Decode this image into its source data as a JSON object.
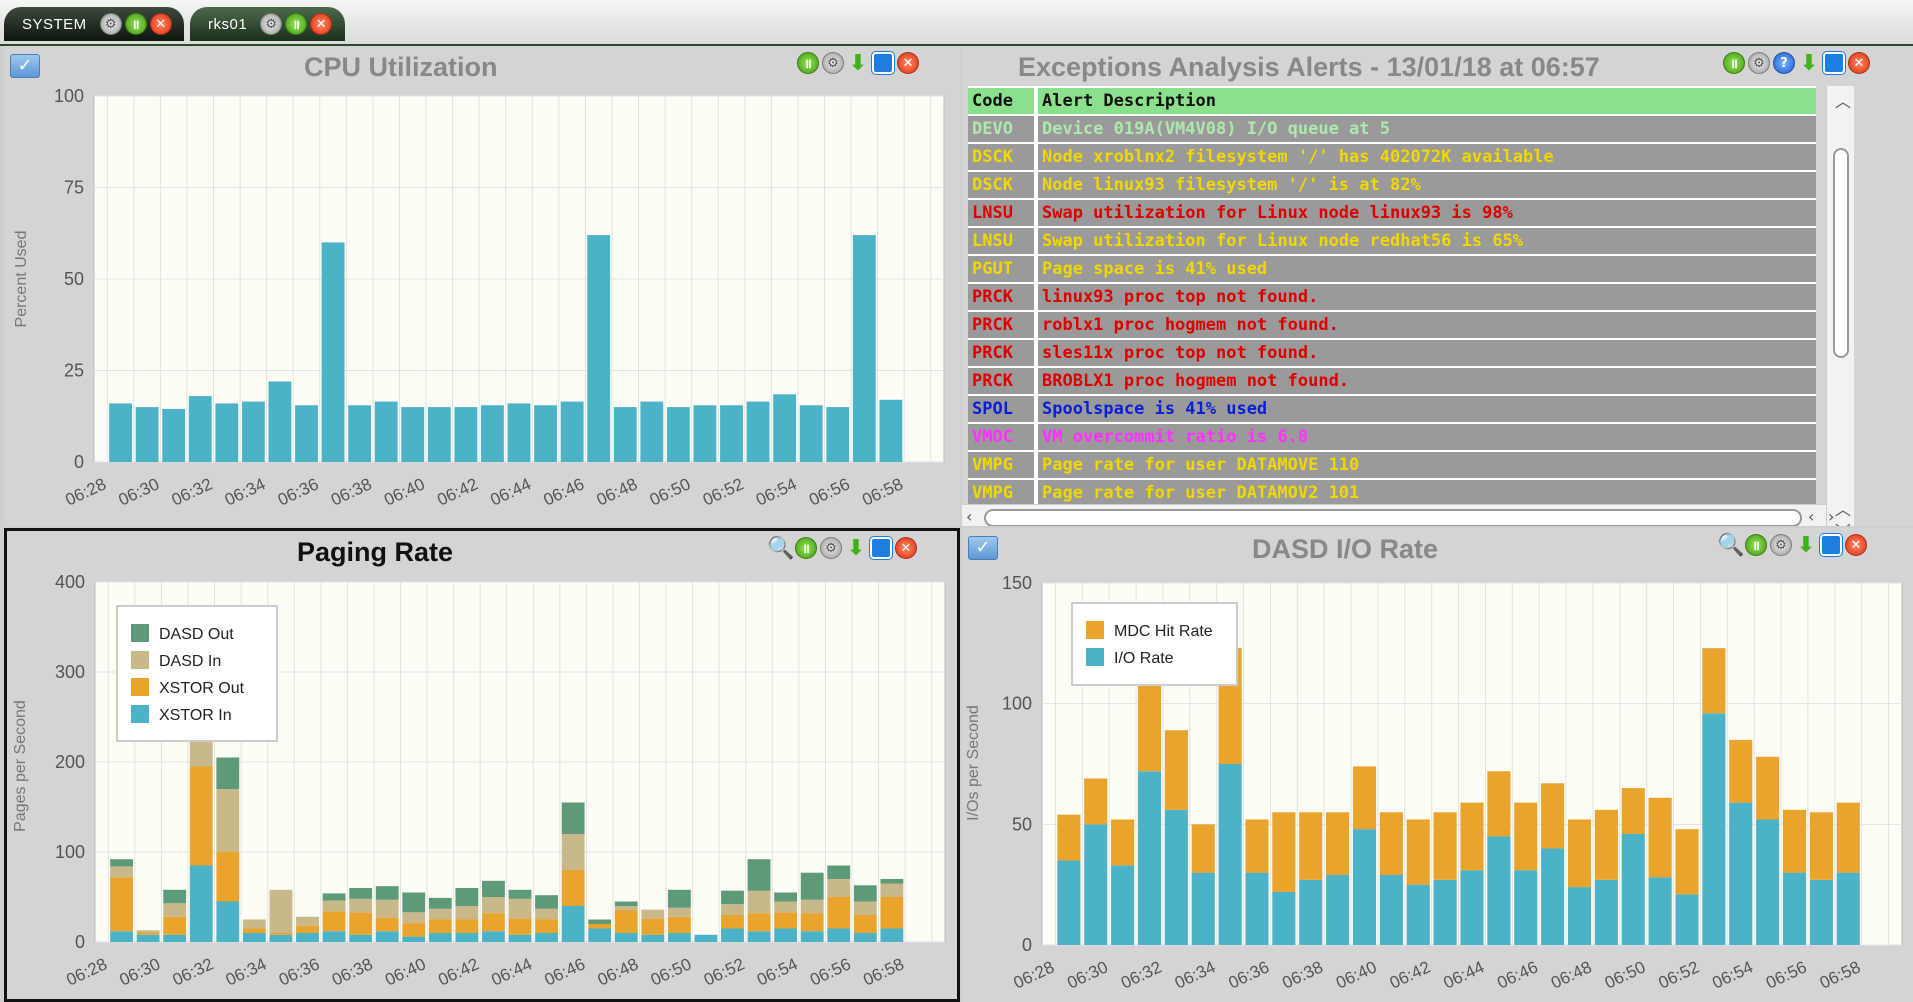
{
  "tabs": [
    {
      "label": "SYSTEM",
      "active": true
    },
    {
      "label": "rks01",
      "active": false
    }
  ],
  "icons": {
    "gear": "gear-icon",
    "pause": "pause-icon",
    "close": "close-icon",
    "maximize": "maximize-icon",
    "download": "download-icon",
    "help": "help-icon",
    "zoom": "magnifier-icon",
    "collapse": "chevron-down-icon"
  },
  "colors": {
    "teal": "#4cb2c8",
    "orange": "#e9a42e",
    "tan": "#c9b88a",
    "green": "#5c9a78",
    "header_green": "#8be08b",
    "row_gray": "#9a9a9a",
    "plot_bg": "#fdfdf6"
  },
  "cpu": {
    "title": "CPU Utilization",
    "chart_data": {
      "type": "bar",
      "title": "CPU Utilization",
      "ylabel": "Percent Used",
      "ylim": [
        0,
        100
      ],
      "yticks": [
        0,
        25,
        50,
        75,
        100
      ],
      "xticks": [
        "06:28",
        "06:30",
        "06:32",
        "06:34",
        "06:36",
        "06:38",
        "06:40",
        "06:42",
        "06:44",
        "06:46",
        "06:48",
        "06:50",
        "06:52",
        "06:54",
        "06:56",
        "06:58"
      ],
      "values": [
        16,
        15,
        14.5,
        18,
        16,
        16.5,
        22,
        15.5,
        60,
        15.5,
        16.5,
        15,
        15,
        15,
        15.5,
        16,
        15.5,
        16.5,
        62,
        15,
        16.5,
        15,
        15.5,
        15.5,
        16.5,
        18.5,
        15.5,
        15,
        62,
        17
      ]
    }
  },
  "alerts": {
    "title": "Exceptions Analysis Alerts - 13/01/18 at 06:57",
    "header": {
      "code": "Code",
      "desc": "Alert Description"
    },
    "rows": [
      {
        "code": "DEVO",
        "desc": "Device 019A(VM4V08) I/O queue at 5",
        "color": "#aee8ae"
      },
      {
        "code": "DSCK",
        "desc": "Node xroblnx2 filesystem '/' has 402072K available",
        "color": "#f0d800"
      },
      {
        "code": "DSCK",
        "desc": "Node linux93 filesystem '/' is at 82%",
        "color": "#f0d800"
      },
      {
        "code": "LNSU",
        "desc": "Swap utilization for Linux node linux93 is 98%",
        "color": "#e00000"
      },
      {
        "code": "LNSU",
        "desc": "Swap utilization for Linux node redhat56 is 65%",
        "color": "#f0d800"
      },
      {
        "code": "PGUT",
        "desc": "Page space is 41% used",
        "color": "#f0d800"
      },
      {
        "code": "PRCK",
        "desc": "linux93 proc top not found.",
        "color": "#e00000"
      },
      {
        "code": "PRCK",
        "desc": "roblx1 proc hogmem not found.",
        "color": "#e00000"
      },
      {
        "code": "PRCK",
        "desc": "sles11x proc top not found.",
        "color": "#e00000"
      },
      {
        "code": "PRCK",
        "desc": "BROBLX1 proc hogmem not found.",
        "color": "#e00000"
      },
      {
        "code": "SPOL",
        "desc": "Spoolspace is 41% used",
        "color": "#0a1ed8"
      },
      {
        "code": "VMOC",
        "desc": "VM overcommit ratio is 6.8",
        "color": "#ff30ff"
      },
      {
        "code": "VMPG",
        "desc": "Page rate for user DATAMOVE 110",
        "color": "#f0d800"
      },
      {
        "code": "VMPG",
        "desc": "Page rate for user DATAMOV2 101",
        "color": "#f0d800"
      }
    ]
  },
  "paging": {
    "title": "Paging Rate",
    "chart_data": {
      "type": "bar",
      "stacked": true,
      "title": "Paging Rate",
      "ylabel": "Pages per Second",
      "ylim": [
        0,
        400
      ],
      "yticks": [
        0,
        100,
        200,
        300,
        400
      ],
      "legend_position": "top-left",
      "xticks": [
        "06:28",
        "06:30",
        "06:32",
        "06:34",
        "06:36",
        "06:38",
        "06:40",
        "06:42",
        "06:44",
        "06:46",
        "06:48",
        "06:50",
        "06:52",
        "06:54",
        "06:56",
        "06:58"
      ],
      "series": [
        {
          "name": "XSTOR In",
          "color": "#4cb2c8",
          "values": [
            12,
            8,
            8,
            85,
            45,
            10,
            8,
            10,
            12,
            8,
            12,
            6,
            10,
            10,
            12,
            8,
            10,
            40,
            15,
            10,
            8,
            10,
            8,
            15,
            12,
            15,
            12,
            15,
            10,
            15
          ]
        },
        {
          "name": "XSTOR Out",
          "color": "#e9a42e",
          "values": [
            60,
            2,
            20,
            110,
            55,
            5,
            2,
            8,
            22,
            25,
            15,
            15,
            15,
            15,
            20,
            18,
            15,
            40,
            5,
            25,
            18,
            18,
            0,
            15,
            20,
            18,
            20,
            35,
            20,
            35
          ]
        },
        {
          "name": "DASD In",
          "color": "#c9b88a",
          "values": [
            12,
            3,
            15,
            135,
            70,
            10,
            48,
            10,
            12,
            15,
            20,
            12,
            12,
            15,
            18,
            22,
            12,
            40,
            0,
            5,
            10,
            10,
            0,
            12,
            25,
            12,
            15,
            20,
            15,
            15
          ]
        },
        {
          "name": "DASD Out",
          "color": "#5c9a78",
          "values": [
            8,
            0,
            15,
            0,
            35,
            0,
            0,
            0,
            8,
            12,
            15,
            22,
            12,
            20,
            18,
            10,
            15,
            35,
            5,
            5,
            0,
            20,
            0,
            15,
            35,
            10,
            30,
            15,
            18,
            5
          ]
        }
      ]
    }
  },
  "dasd": {
    "title": "DASD I/O Rate",
    "chart_data": {
      "type": "bar",
      "stacked": true,
      "title": "DASD I/O Rate",
      "ylabel": "I/Os per Second",
      "ylim": [
        0,
        150
      ],
      "yticks": [
        0,
        50,
        100,
        150
      ],
      "legend_position": "top-left",
      "xticks": [
        "06:28",
        "06:30",
        "06:32",
        "06:34",
        "06:36",
        "06:38",
        "06:40",
        "06:42",
        "06:44",
        "06:46",
        "06:48",
        "06:50",
        "06:52",
        "06:54",
        "06:56",
        "06:58"
      ],
      "series": [
        {
          "name": "I/O Rate",
          "color": "#4cb2c8",
          "values": [
            35,
            50,
            33,
            72,
            56,
            30,
            75,
            30,
            22,
            27,
            29,
            48,
            29,
            25,
            27,
            31,
            45,
            31,
            40,
            24,
            27,
            46,
            28,
            21,
            96,
            59,
            52,
            30,
            27,
            30
          ]
        },
        {
          "name": "MDC Hit Rate",
          "color": "#e9a42e",
          "values": [
            19,
            19,
            19,
            52,
            33,
            20,
            48,
            22,
            33,
            28,
            26,
            26,
            26,
            27,
            28,
            28,
            27,
            28,
            27,
            28,
            29,
            19,
            33,
            27,
            27,
            26,
            26,
            26,
            28,
            29
          ]
        }
      ]
    }
  }
}
